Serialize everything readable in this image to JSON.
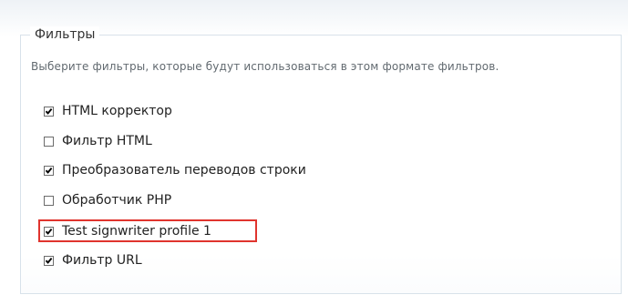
{
  "fieldset": {
    "legend": "Фильтры",
    "description": "Выберите фильтры, которые будут использоваться в этом формате фильтров.",
    "filters": [
      {
        "label": "HTML корректор",
        "checked": true
      },
      {
        "label": "Фильтр HTML",
        "checked": false
      },
      {
        "label": "Преобразователь переводов строки",
        "checked": true
      },
      {
        "label": "Обработчик PHP",
        "checked": false
      },
      {
        "label": "Test signwriter profile 1",
        "checked": true,
        "highlighted": true
      },
      {
        "label": "Фильтр URL",
        "checked": true
      }
    ]
  },
  "colors": {
    "highlight": "#e0342e",
    "fieldset_border": "#d8e2ea",
    "description_text": "#626a70"
  }
}
